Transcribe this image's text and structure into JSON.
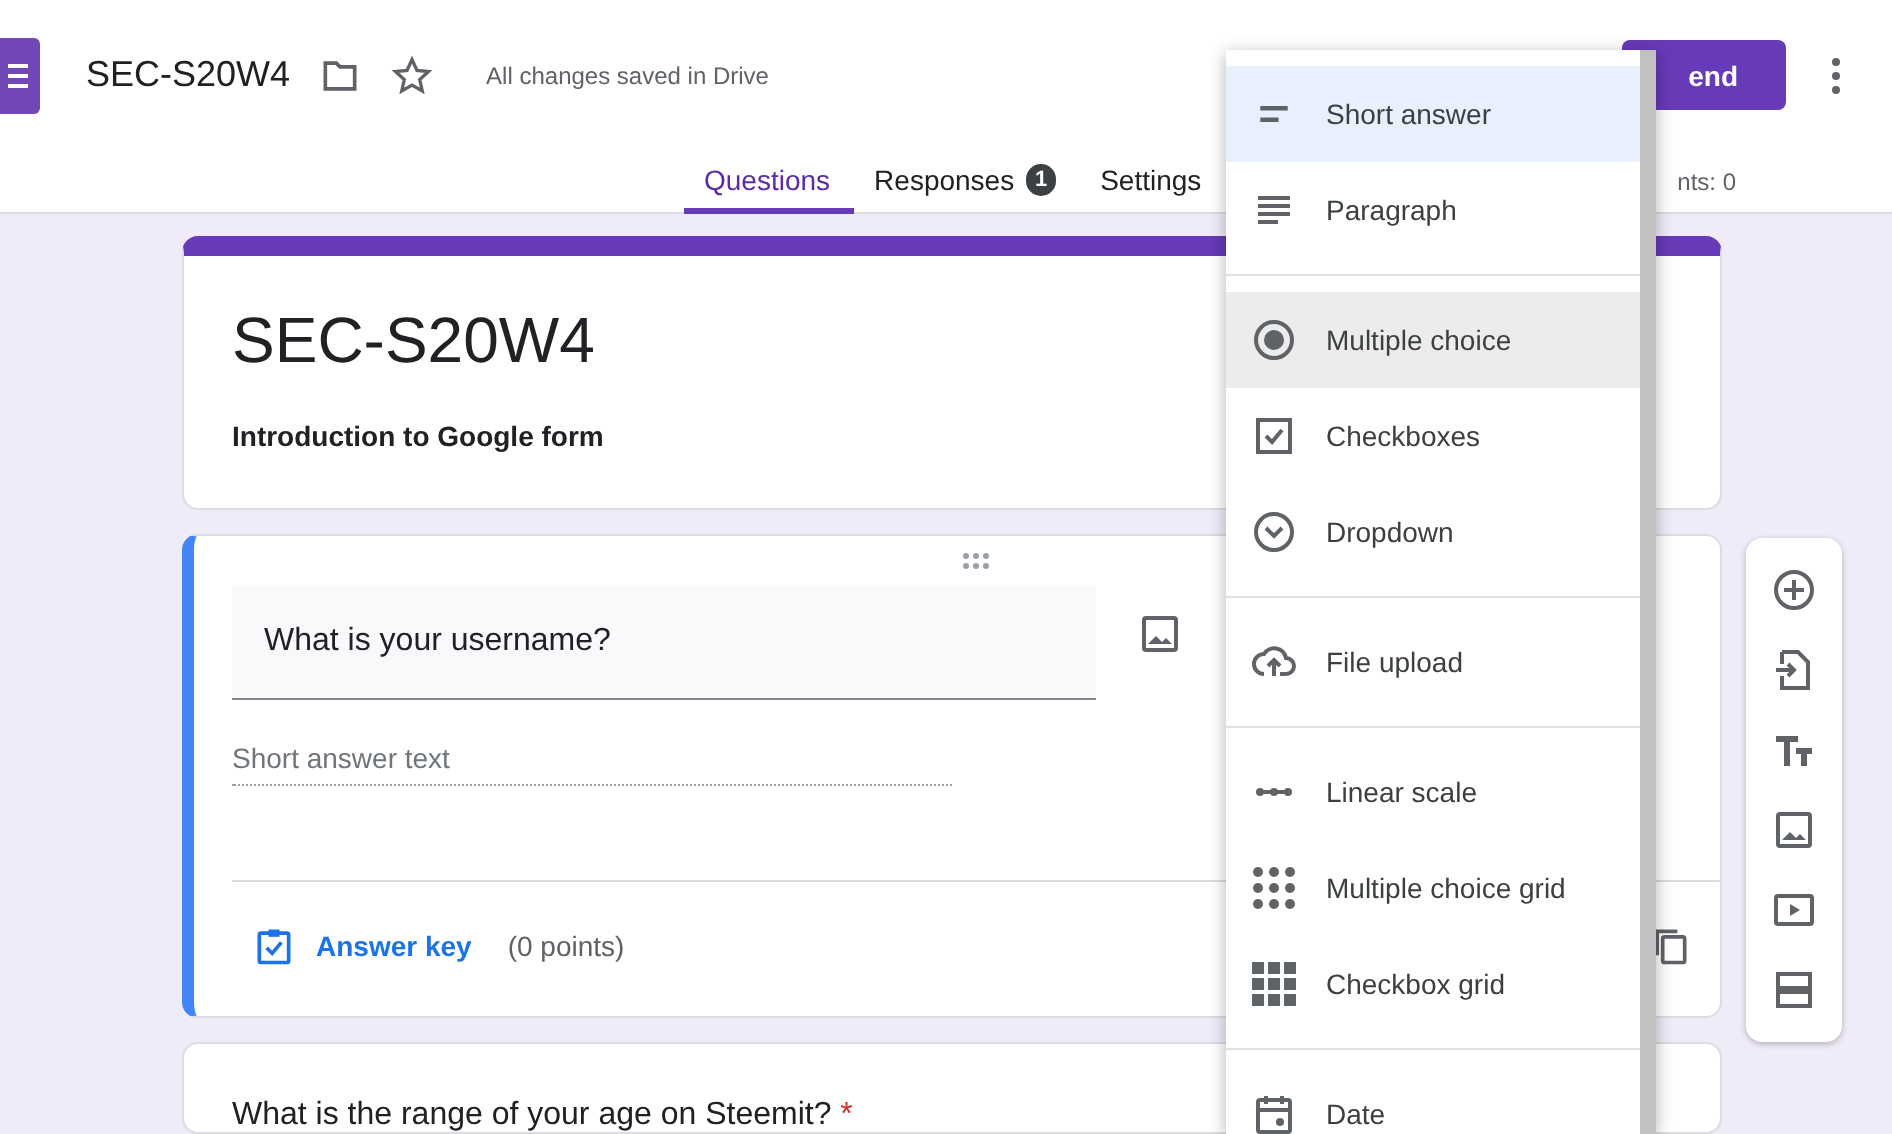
{
  "header": {
    "title": "SEC-S20W4",
    "save_status": "All changes saved in Drive",
    "send_button": "end"
  },
  "tabs": [
    {
      "label": "Questions",
      "selected": true
    },
    {
      "label": "Responses",
      "selected": false,
      "badge": "1"
    },
    {
      "label": "Settings",
      "selected": false
    }
  ],
  "total_points": "nts: 0",
  "form": {
    "title": "SEC-S20W4",
    "description": "Introduction to Google form"
  },
  "questions": [
    {
      "title": "What is your username?",
      "focused": true,
      "answer_placeholder": "Short answer text",
      "answer_key": "Answer key",
      "points": "(0 points)"
    },
    {
      "title": "What is the range of your age on Steemit?",
      "focused": false,
      "required_mark": "*"
    }
  ],
  "question_type_menu": {
    "groups": [
      {
        "items": [
          {
            "label": "Short answer",
            "selected": true,
            "hovered": false
          },
          {
            "label": "Paragraph",
            "selected": false,
            "hovered": false
          }
        ]
      },
      {
        "items": [
          {
            "label": "Multiple choice",
            "selected": false,
            "hovered": true
          },
          {
            "label": "Checkboxes",
            "selected": false,
            "hovered": false
          },
          {
            "label": "Dropdown",
            "selected": false,
            "hovered": false
          }
        ]
      },
      {
        "items": [
          {
            "label": "File upload",
            "selected": false,
            "hovered": false
          }
        ]
      },
      {
        "items": [
          {
            "label": "Linear scale",
            "selected": false,
            "hovered": false
          },
          {
            "label": "Multiple choice grid",
            "selected": false,
            "hovered": false
          },
          {
            "label": "Checkbox grid",
            "selected": false,
            "hovered": false
          }
        ]
      },
      {
        "items": [
          {
            "label": "Date",
            "selected": false,
            "hovered": false
          }
        ]
      }
    ]
  }
}
